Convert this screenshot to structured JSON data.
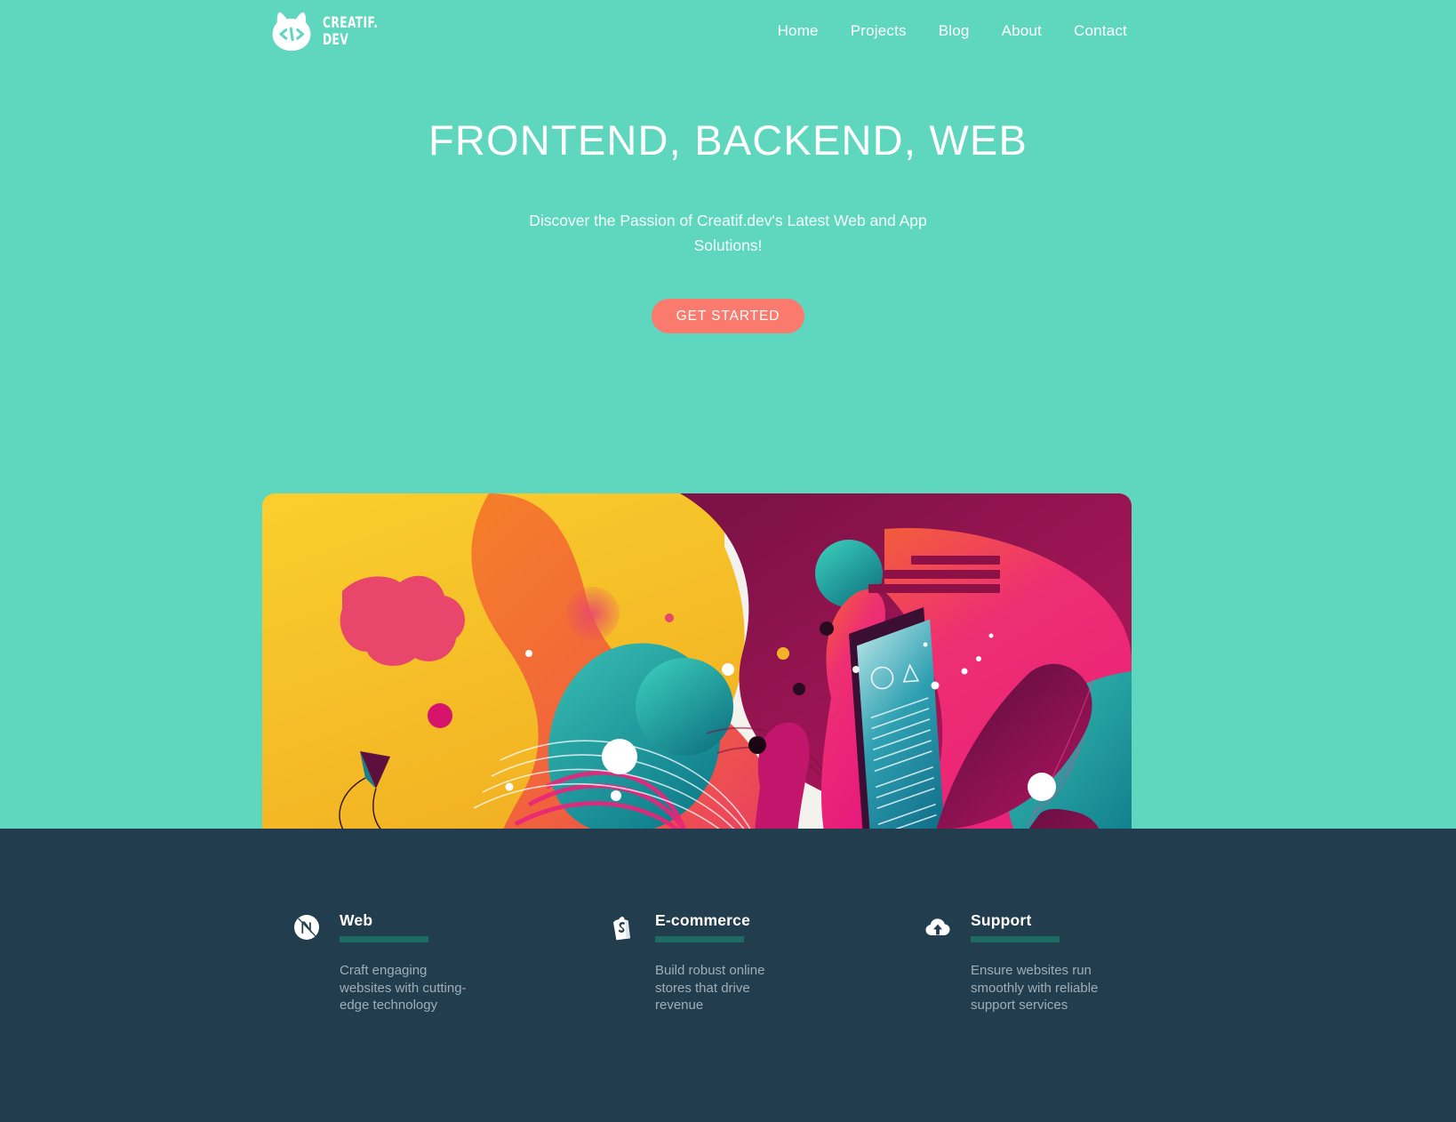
{
  "theme": {
    "background": "#5fd6be",
    "footer_background": "#213d4e",
    "accent_button": "#fa7a6e",
    "rule_color": "#1e6b63",
    "text_light": "#ffffff",
    "text_muted": "#9fafb9"
  },
  "header": {
    "logo_icon": "cat-code-logo-icon",
    "brand_name": "CREATIF.\nDEV",
    "nav": [
      {
        "label": "Home"
      },
      {
        "label": "Projects"
      },
      {
        "label": "Blog"
      },
      {
        "label": "About"
      },
      {
        "label": "Contact"
      }
    ]
  },
  "hero": {
    "title": "FRONTEND, BACKEND, WEB",
    "subtitle": "Discover the Passion of Creatif.dev's Latest Web and App Solutions!",
    "cta_label": "GET STARTED",
    "illustration_alt": "abstract-colorful-illustration"
  },
  "features": [
    {
      "icon": "nextjs-icon",
      "title": "Web",
      "description": "Craft engaging websites with cutting-edge technology"
    },
    {
      "icon": "shopify-bag-icon",
      "title": "E-commerce",
      "description": "Build robust online stores that drive revenue"
    },
    {
      "icon": "cloud-upload-icon",
      "title": "Support",
      "description": "Ensure websites run smoothly with reliable support services"
    }
  ]
}
